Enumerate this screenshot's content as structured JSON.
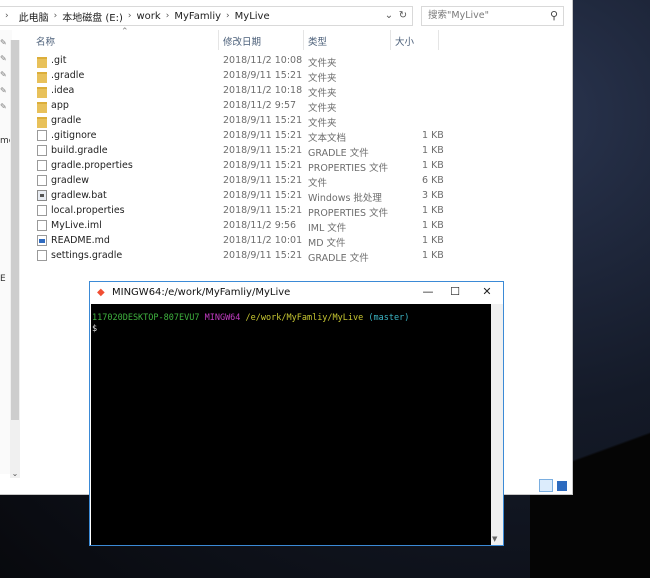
{
  "explorer": {
    "breadcrumbs": [
      "此电脑",
      "本地磁盘 (E:)",
      "work",
      "MyFamliy",
      "MyLive"
    ],
    "search_placeholder": "搜索\"MyLive\"",
    "columns": {
      "name": "名称",
      "date": "修改日期",
      "type": "类型",
      "size": "大小"
    },
    "nav_cut_labels": [
      "me",
      "E"
    ],
    "files": [
      {
        "name": ".git",
        "date": "2018/11/2 10:08",
        "type": "文件夹",
        "size": "",
        "kind": "folder"
      },
      {
        "name": ".gradle",
        "date": "2018/9/11 15:21",
        "type": "文件夹",
        "size": "",
        "kind": "folder"
      },
      {
        "name": ".idea",
        "date": "2018/11/2 10:18",
        "type": "文件夹",
        "size": "",
        "kind": "folder"
      },
      {
        "name": "app",
        "date": "2018/11/2 9:57",
        "type": "文件夹",
        "size": "",
        "kind": "folder"
      },
      {
        "name": "gradle",
        "date": "2018/9/11 15:21",
        "type": "文件夹",
        "size": "",
        "kind": "folder"
      },
      {
        "name": ".gitignore",
        "date": "2018/9/11 15:21",
        "type": "文本文档",
        "size": "1 KB",
        "kind": "file"
      },
      {
        "name": "build.gradle",
        "date": "2018/9/11 15:21",
        "type": "GRADLE 文件",
        "size": "1 KB",
        "kind": "file"
      },
      {
        "name": "gradle.properties",
        "date": "2018/9/11 15:21",
        "type": "PROPERTIES 文件",
        "size": "1 KB",
        "kind": "file"
      },
      {
        "name": "gradlew",
        "date": "2018/9/11 15:21",
        "type": "文件",
        "size": "6 KB",
        "kind": "file"
      },
      {
        "name": "gradlew.bat",
        "date": "2018/9/11 15:21",
        "type": "Windows 批处理",
        "size": "3 KB",
        "kind": "bat"
      },
      {
        "name": "local.properties",
        "date": "2018/9/11 15:21",
        "type": "PROPERTIES 文件",
        "size": "1 KB",
        "kind": "file"
      },
      {
        "name": "MyLive.iml",
        "date": "2018/11/2 9:56",
        "type": "IML 文件",
        "size": "1 KB",
        "kind": "file"
      },
      {
        "name": "README.md",
        "date": "2018/11/2 10:01",
        "type": "MD 文件",
        "size": "1 KB",
        "kind": "md"
      },
      {
        "name": "settings.gradle",
        "date": "2018/9/11 15:21",
        "type": "GRADLE 文件",
        "size": "1 KB",
        "kind": "file"
      }
    ]
  },
  "terminal": {
    "title": "MINGW64:/e/work/MyFamliy/MyLive",
    "prompt_user": "117020DESKTOP-807EVU7",
    "prompt_env": "MINGW64",
    "prompt_path": "/e/work/MyFamliy/MyLive",
    "prompt_branch": "(master)",
    "cursor": "$"
  },
  "colors": {
    "terminal_border": "#3b8ad6",
    "prompt_user": "#3fb33f",
    "prompt_env": "#c33cc3",
    "prompt_path": "#c8c832",
    "prompt_branch": "#3cb6c6"
  }
}
